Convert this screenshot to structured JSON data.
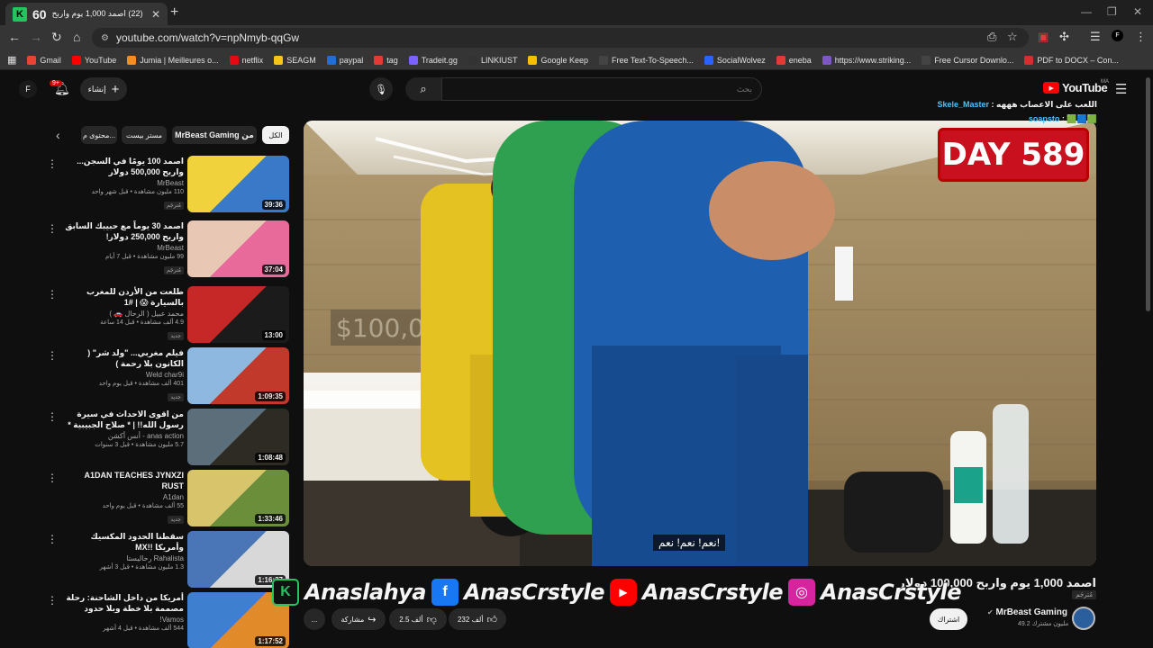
{
  "browser": {
    "tab_title": "(22) اصمد 1,000 يوم واربح",
    "tab_logo": "K",
    "tab_count": "60",
    "url": "youtube.com/watch?v=npNmyb-qqGw",
    "bookmarks": [
      {
        "label": "Gmail",
        "color": "#ea4335"
      },
      {
        "label": "YouTube",
        "color": "#ff0000"
      },
      {
        "label": "Jumia | Meilleures o...",
        "color": "#f68b1e"
      },
      {
        "label": "netflix",
        "color": "#e50914"
      },
      {
        "label": "SEAGM",
        "color": "#f5c518"
      },
      {
        "label": "paypal",
        "color": "#1f6fd6"
      },
      {
        "label": "tag",
        "color": "#e53935"
      },
      {
        "label": "Tradeit.gg",
        "color": "#7b61ff"
      },
      {
        "label": "LINKIUST",
        "color": "#333333"
      },
      {
        "label": "Google Keep",
        "color": "#fbbc04"
      },
      {
        "label": "Free Text-To-Speech...",
        "color": "#444444"
      },
      {
        "label": "SocialWolvez",
        "color": "#2962ff"
      },
      {
        "label": "eneba",
        "color": "#e53935"
      },
      {
        "label": "https://www.striking...",
        "color": "#7e57c2"
      },
      {
        "label": "Free Cursor Downlo...",
        "color": "#444444"
      },
      {
        "label": "PDF to DOCX – Con...",
        "color": "#d32f2f"
      }
    ]
  },
  "masthead": {
    "avatar_letter": "F",
    "notif_count": "9+",
    "create_label": "إنشاء",
    "search_placeholder": "بحث",
    "logo_text": "YouTube",
    "country": "MA"
  },
  "chips": [
    "الكل",
    "MrBeast Gaming من",
    "مستر بيست",
    "محتوى م..."
  ],
  "recommended": [
    {
      "title": "اصمد 100 يومًا في السجن... واربح 500,000 دولار",
      "channel": "MrBeast",
      "meta": "110 مليون مشاهدة • قبل شهر واحد",
      "badge": "مُترجَم",
      "duration": "39:36",
      "color1": "#f0d23c",
      "color2": "#3a78c8"
    },
    {
      "title": "اصمد 30 يوماً مع حبيبك السابق واربح 250,000 دولار!",
      "channel": "MrBeast",
      "meta": "99 مليون مشاهدة • قبل 7 أيام",
      "badge": "مُترجَم",
      "duration": "37:04",
      "color1": "#e8c8b4",
      "color2": "#e86a9a"
    },
    {
      "title": "طلعت من الأردن للمغرب بالسيارة 😱 | #1",
      "channel": "محمد عبيل ( الرحال 🚗 )",
      "meta": "4.9 ألف مشاهدة • قبل 14 ساعة",
      "badge": "جديد",
      "duration": "13:00",
      "color1": "#c62828",
      "color2": "#1b1b1b"
    },
    {
      "title": "فيلم مغربي... \"ولد شر\" ( الكانون بلا رحمة )",
      "channel": "Weld char9i",
      "meta": "401 ألف مشاهدة • قبل يوم واحد",
      "badge": "جديد",
      "duration": "1:09:35",
      "color1": "#8fb8e0",
      "color2": "#c0392b"
    },
    {
      "title": "من اقوى الاحداث في سيرة رسول الله!! | * صلاح الجبيبية * كاملة ( احداث اول مره ...",
      "channel": "anas action - أنس أكشن",
      "meta": "5.7 مليون مشاهدة • قبل 3 سنوات",
      "badge": "",
      "duration": "1:08:48",
      "color1": "#5b6e7a",
      "color2": "#2e2a24"
    },
    {
      "title": "A1DAN TEACHES JYNXZI RUST",
      "channel": "A1dan",
      "meta": "55 ألف مشاهدة • قبل يوم واحد",
      "badge": "جديد",
      "duration": "1:33:46",
      "color1": "#d8c46a",
      "color2": "#6b8e3a"
    },
    {
      "title": "سقطنا الحدود المكسيك وأمريكا !!MX",
      "channel": "Rahalista رحاليستا",
      "meta": "1.3 مليون مشاهدة • قبل 3 أشهر",
      "badge": "",
      "duration": "1:16:37",
      "color1": "#4a76b8",
      "color2": "#d8d8d8"
    },
    {
      "title": "أمريكا من داخل الشاحنة: رحلة مصممة بلا خطة وبلا حدود",
      "channel": "Vamos!",
      "meta": "544 ألف مشاهدة • قبل 4 أشهر",
      "badge": "",
      "duration": "1:17:52",
      "color1": "#3f7fd0",
      "color2": "#e08a2a"
    }
  ],
  "player": {
    "day_badge": "DAY 589",
    "subtitle": "نعم! نعم! نعم!"
  },
  "chat": [
    {
      "user": "Skele_Master",
      "text": "اللعب على الاعصاب هههه"
    },
    {
      "user": "soapsto",
      "text": "🟩🟦🟩"
    }
  ],
  "social_banner": {
    "k_logo": "K",
    "items": [
      {
        "icon": "facebook-icon",
        "glyph": "f",
        "color": "#1877f2",
        "handle": "Anaslahya"
      },
      {
        "icon": "youtube-icon",
        "glyph": "▶",
        "color": "#ff0000",
        "handle": "AnasCrstyle"
      },
      {
        "icon": "instagram-icon",
        "glyph": "◎",
        "color": "#d6249f",
        "handle": "AnasCrstyle"
      }
    ],
    "first_handle": "Anaslahya",
    "fb_handle": "AnasCrstyle",
    "yt_handle": "AnasCrstyle",
    "ig_handle": "AnasCrstyle"
  },
  "video": {
    "title": "اصمد 1,000 يوم واربح 100,000 دولار",
    "badge": "مُترجَم",
    "channel": "MrBeast Gaming",
    "subscribers": "49.2 مليون مشترك",
    "subscribe_label": "اشتراك",
    "likes": "232 ألف",
    "dislikes": "2.5 ألف",
    "share_label": "مشاركة",
    "more_label": "..."
  }
}
